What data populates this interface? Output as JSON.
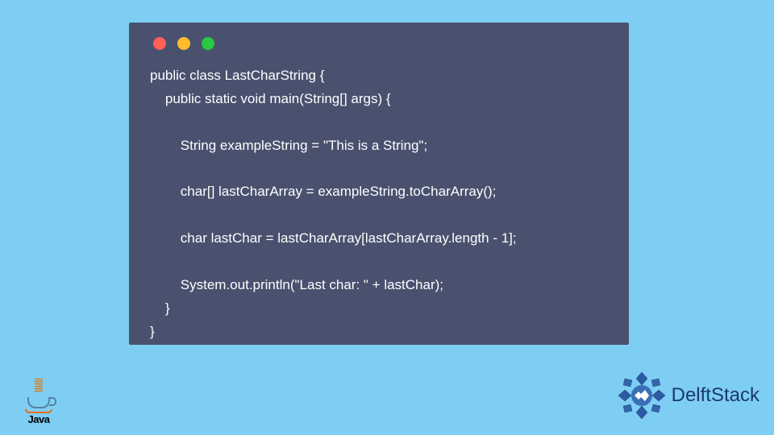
{
  "code": {
    "line1": "public class LastCharString {",
    "line2": "    public static void main(String[] args) {",
    "line3": "",
    "line4": "        String exampleString = \"This is a String\";",
    "line5": "",
    "line6": "        char[] lastCharArray = exampleString.toCharArray();",
    "line7": "",
    "line8": "        char lastChar = lastCharArray[lastCharArray.length - 1];",
    "line9": "",
    "line10": "        System.out.println(\"Last char: \" + lastChar);",
    "line11": "    }",
    "line12": "}"
  },
  "logos": {
    "java_label": "Java",
    "delft_label": "DelftStack"
  },
  "colors": {
    "background": "#7ecef4",
    "code_bg": "#49516f",
    "dot_red": "#ff5f56",
    "dot_yellow": "#ffbd2e",
    "dot_green": "#27c93f",
    "delft_blue": "#1b3a6b"
  }
}
